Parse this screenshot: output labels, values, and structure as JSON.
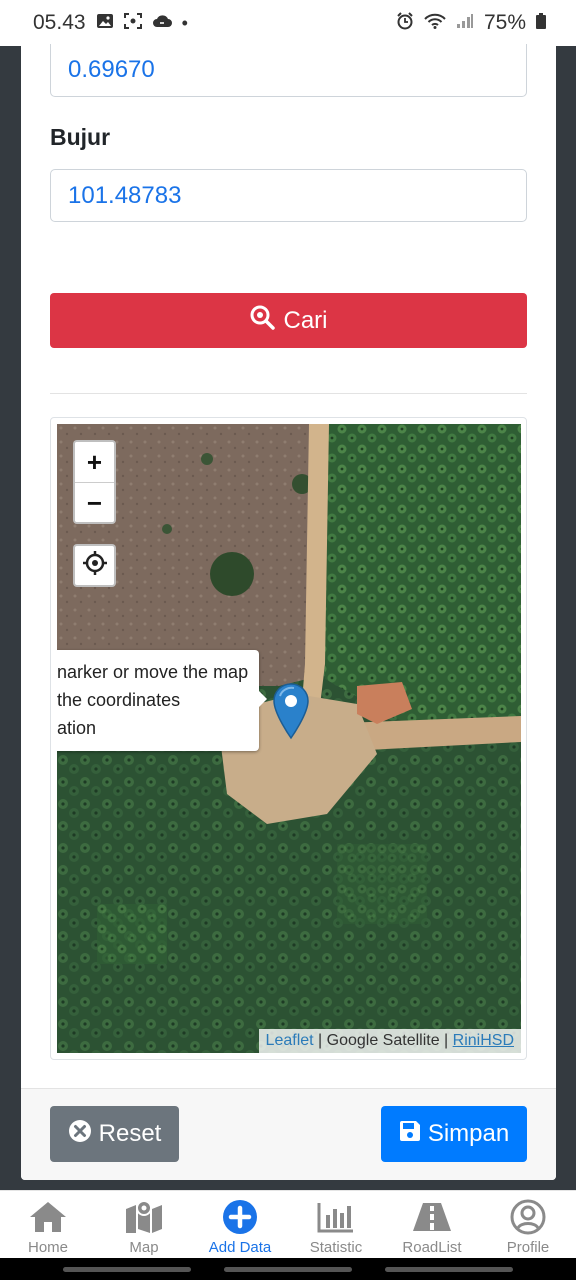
{
  "status_bar": {
    "time": "05.43",
    "battery": "75%"
  },
  "form": {
    "latitude_value": "0.69670",
    "longitude_label": "Bujur",
    "longitude_value": "101.48783",
    "search_label": "Cari"
  },
  "map": {
    "zoom_in": "+",
    "zoom_out": "−",
    "tooltip_lines": [
      "narker or move the map",
      " the coordinates",
      "ation"
    ],
    "attribution": {
      "leaflet": "Leaflet",
      "sep1": " | ",
      "provider": "Google Satellite",
      "sep2": " | ",
      "author": "RiniHSD"
    }
  },
  "footer": {
    "reset_label": "Reset",
    "save_label": "Simpan"
  },
  "bottom_nav": {
    "items": [
      {
        "label": "Home",
        "icon": "home-icon"
      },
      {
        "label": "Map",
        "icon": "map-icon"
      },
      {
        "label": "Add Data",
        "icon": "add-circle-icon",
        "active": true
      },
      {
        "label": "Statistic",
        "icon": "bar-chart-icon"
      },
      {
        "label": "RoadList",
        "icon": "road-icon"
      },
      {
        "label": "Profile",
        "icon": "user-circle-icon"
      }
    ]
  },
  "colors": {
    "primary": "#007bff",
    "danger": "#dc3545",
    "secondary": "#6c757d",
    "active_nav": "#1a73e8"
  }
}
